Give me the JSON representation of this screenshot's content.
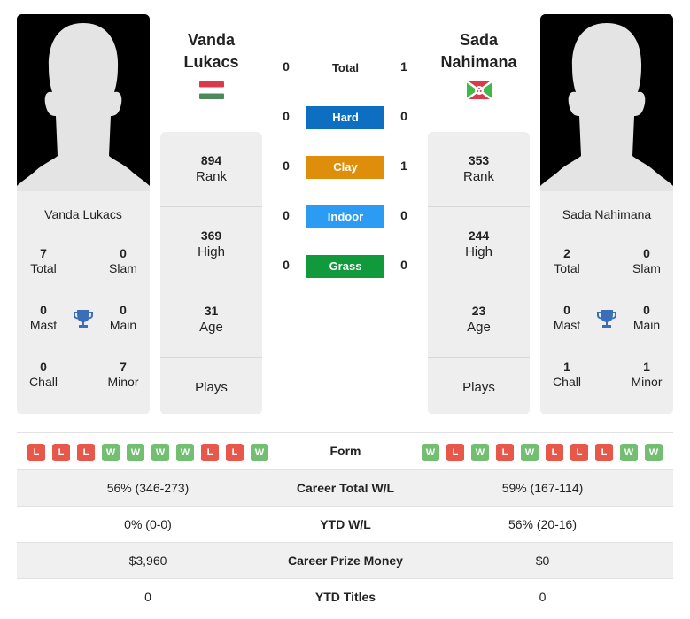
{
  "colors": {
    "hard": "#0e6fc2",
    "clay": "#de8e0a",
    "indoor": "#2b9bf4",
    "grass": "#119a3b",
    "win": "#72bf72",
    "loss": "#e8584a",
    "trophy": "#3a6fb8"
  },
  "player1": {
    "name_line1": "Vanda",
    "name_line2": "Lukacs",
    "full_name": "Vanda Lukacs",
    "flag": "hungary-flag",
    "titles": {
      "total": {
        "value": "7",
        "label": "Total"
      },
      "slam": {
        "value": "0",
        "label": "Slam"
      },
      "mast": {
        "value": "0",
        "label": "Mast"
      },
      "main": {
        "value": "0",
        "label": "Main"
      },
      "chall": {
        "value": "0",
        "label": "Chall"
      },
      "minor": {
        "value": "7",
        "label": "Minor"
      }
    },
    "rank": {
      "value": "894",
      "label": "Rank"
    },
    "high": {
      "value": "369",
      "label": "High"
    },
    "age": {
      "value": "31",
      "label": "Age"
    },
    "plays": {
      "value": "",
      "label": "Plays"
    },
    "form": [
      "L",
      "L",
      "L",
      "W",
      "W",
      "W",
      "W",
      "L",
      "L",
      "W"
    ]
  },
  "player2": {
    "name_line1": "Sada",
    "name_line2": "Nahimana",
    "full_name": "Sada Nahimana",
    "flag": "burundi-flag",
    "titles": {
      "total": {
        "value": "2",
        "label": "Total"
      },
      "slam": {
        "value": "0",
        "label": "Slam"
      },
      "mast": {
        "value": "0",
        "label": "Mast"
      },
      "main": {
        "value": "0",
        "label": "Main"
      },
      "chall": {
        "value": "1",
        "label": "Chall"
      },
      "minor": {
        "value": "1",
        "label": "Minor"
      }
    },
    "rank": {
      "value": "353",
      "label": "Rank"
    },
    "high": {
      "value": "244",
      "label": "High"
    },
    "age": {
      "value": "23",
      "label": "Age"
    },
    "plays": {
      "value": "",
      "label": "Plays"
    },
    "form": [
      "W",
      "L",
      "W",
      "L",
      "W",
      "L",
      "L",
      "L",
      "W",
      "W"
    ]
  },
  "h2h": {
    "total": {
      "label": "Total",
      "p1": "0",
      "p2": "1"
    },
    "hard": {
      "label": "Hard",
      "p1": "0",
      "p2": "0"
    },
    "clay": {
      "label": "Clay",
      "p1": "0",
      "p2": "1"
    },
    "indoor": {
      "label": "Indoor",
      "p1": "0",
      "p2": "0"
    },
    "grass": {
      "label": "Grass",
      "p1": "0",
      "p2": "0"
    }
  },
  "comparison": {
    "form_label": "Form",
    "rows": [
      {
        "label": "Career Total W/L",
        "p1": "56% (346-273)",
        "p2": "59% (167-114)"
      },
      {
        "label": "YTD W/L",
        "p1": "0% (0-0)",
        "p2": "56% (20-16)"
      },
      {
        "label": "Career Prize Money",
        "p1": "$3,960",
        "p2": "$0"
      },
      {
        "label": "YTD Titles",
        "p1": "0",
        "p2": "0"
      }
    ]
  }
}
